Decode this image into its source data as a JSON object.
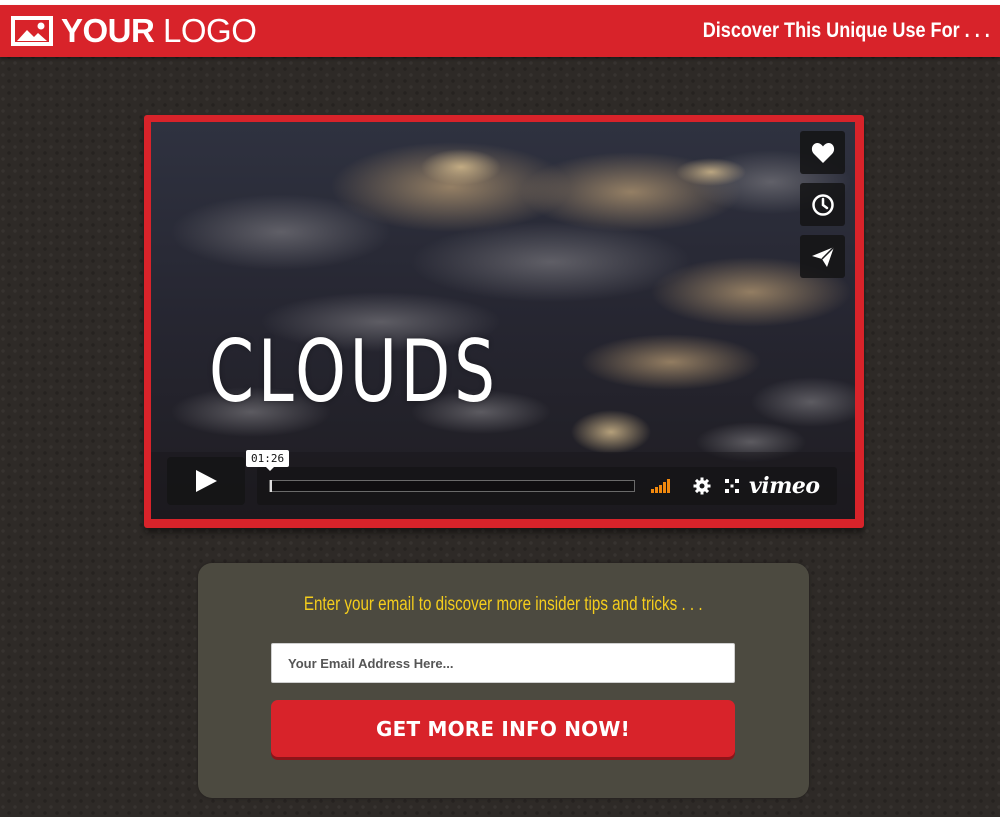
{
  "header": {
    "logo_bold": "YOUR",
    "logo_light": "LOGO",
    "tagline": "Discover This Unique Use For . . ."
  },
  "video": {
    "title": "CLOUDS",
    "current_time": "01:26",
    "progress_fraction": 0.0,
    "provider": "vimeo",
    "side_buttons": [
      "heart-icon",
      "clock-icon",
      "send-icon"
    ]
  },
  "optin": {
    "heading": "Enter your email to discover more insider tips and tricks . . .",
    "email_placeholder": "Your Email Address Here...",
    "email_value": "",
    "cta_label": "GET MORE INFO NOW!"
  },
  "colors": {
    "brand_red": "#d8232a",
    "heading_yellow": "#f4cd1c",
    "panel": "#4c4a40",
    "background": "#2e2a27",
    "volume_orange": "#f2890e"
  }
}
